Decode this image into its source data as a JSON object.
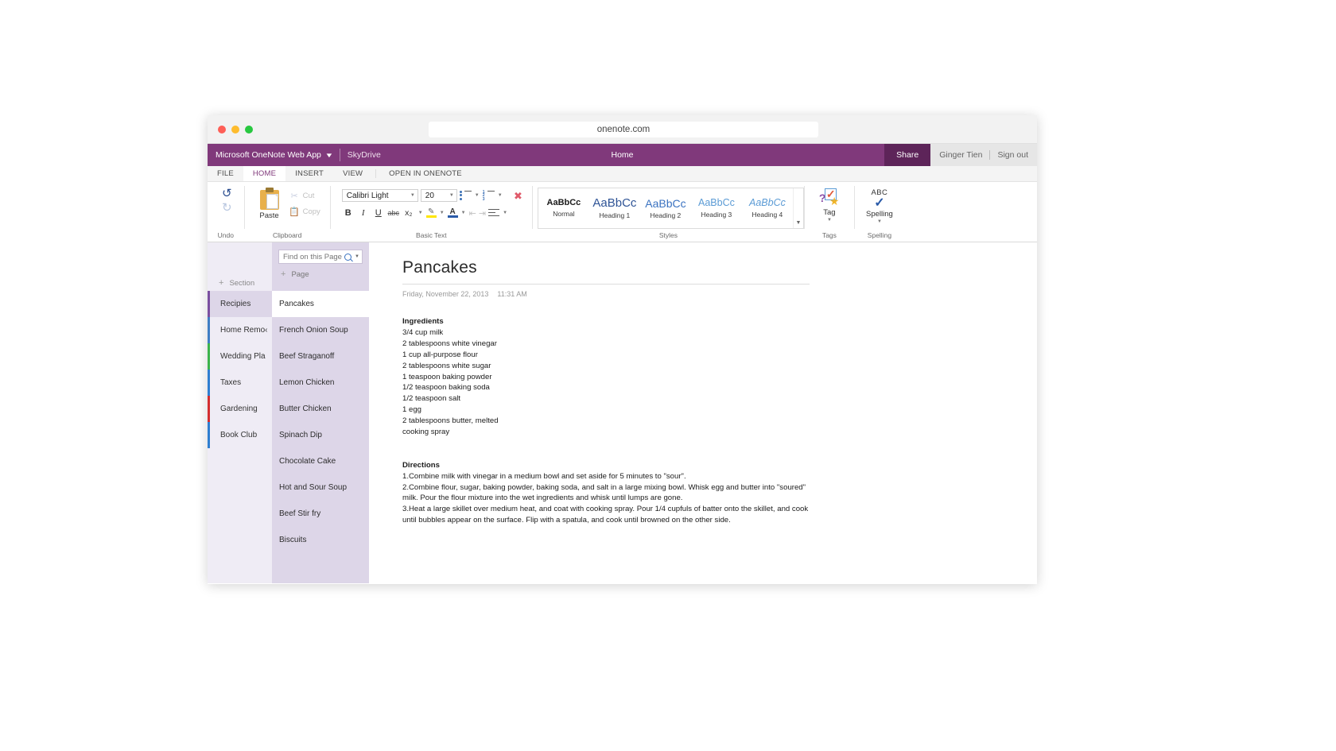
{
  "browser": {
    "url": "onenote.com"
  },
  "titlebar": {
    "brand": "Microsoft OneNote Web App",
    "location": "SkyDrive",
    "doc_title": "Home",
    "share_label": "Share",
    "user_name": "Ginger Tien",
    "sign_out": "Sign out",
    "brand_color": "#80397b",
    "share_color": "#5d2459"
  },
  "ribbon": {
    "tabs": [
      {
        "label": "FILE",
        "active": false
      },
      {
        "label": "HOME",
        "active": true
      },
      {
        "label": "INSERT",
        "active": false
      },
      {
        "label": "VIEW",
        "active": false
      },
      {
        "label": "OPEN IN ONENOTE",
        "active": false
      }
    ],
    "groups": {
      "undo": {
        "label": "Undo"
      },
      "clipboard": {
        "label": "Clipboard",
        "paste": "Paste",
        "cut": "Cut",
        "copy": "Copy"
      },
      "basic_text": {
        "label": "Basic Text",
        "font_family": "Calibri Light",
        "font_size": "20"
      },
      "styles": {
        "label": "Styles",
        "items": [
          {
            "sample": "AaBbCc",
            "name": "Normal"
          },
          {
            "sample": "AaBbCc",
            "name": "Heading 1"
          },
          {
            "sample": "AaBbCc",
            "name": "Heading 2"
          },
          {
            "sample": "AaBbCc",
            "name": "Heading 3"
          },
          {
            "sample": "AaBbCc",
            "name": "Heading 4"
          }
        ]
      },
      "tags": {
        "label": "Tags",
        "button": "Tag"
      },
      "spelling": {
        "label": "Spelling",
        "button": "Spelling",
        "abc": "ABC"
      }
    }
  },
  "sidebar": {
    "add_section": "Section",
    "sections": [
      {
        "label": "Recipies",
        "color": "#7a4fa0",
        "active": true
      },
      {
        "label": "Home Remo‹",
        "color": "#3f7ec4",
        "active": false
      },
      {
        "label": "Wedding Pla",
        "color": "#3cb44b",
        "active": false
      },
      {
        "label": "Taxes",
        "color": "#2f7fd0",
        "active": false
      },
      {
        "label": "Gardening",
        "color": "#d42f2f",
        "active": false
      },
      {
        "label": "Book Club",
        "color": "#2f7fd0",
        "active": false
      }
    ]
  },
  "pages": {
    "search_placeholder": "Find on this Page",
    "search_value": "",
    "add_page": "Page",
    "items": [
      {
        "label": "Pancakes",
        "active": true
      },
      {
        "label": "French Onion Soup",
        "active": false
      },
      {
        "label": "Beef Straganoff",
        "active": false
      },
      {
        "label": "Lemon Chicken",
        "active": false
      },
      {
        "label": "Butter Chicken",
        "active": false
      },
      {
        "label": "Spinach Dip",
        "active": false
      },
      {
        "label": "Chocolate Cake",
        "active": false
      },
      {
        "label": "Hot and Sour Soup",
        "active": false
      },
      {
        "label": "Beef Stir fry",
        "active": false
      },
      {
        "label": "Biscuits",
        "active": false
      }
    ]
  },
  "note": {
    "title": "Pancakes",
    "date": "Friday, November 22, 2013",
    "time": "11:31 AM",
    "ingredients_heading": "Ingredients",
    "ingredients": [
      "3/4 cup milk",
      "2 tablespoons white vinegar",
      "1 cup all-purpose flour",
      "2 tablespoons white sugar",
      "1 teaspoon baking powder",
      "1/2 teaspoon baking soda",
      "1/2 teaspoon salt",
      "1 egg",
      "2 tablespoons butter, melted",
      "cooking spray"
    ],
    "directions_heading": "Directions",
    "directions": [
      "1.Combine milk with vinegar in a medium bowl and set aside for 5 minutes to \"sour\".",
      "2.Combine flour, sugar, baking powder, baking soda, and salt in a large mixing bowl. Whisk egg and butter into \"soured\" milk. Pour the flour mixture into the wet ingredients and whisk until lumps are gone.",
      "3.Heat a large skillet over medium heat, and coat with cooking spray. Pour 1/4 cupfuls of batter onto the skillet, and cook until bubbles appear on the surface. Flip with a spatula, and cook until browned on the other side."
    ]
  }
}
